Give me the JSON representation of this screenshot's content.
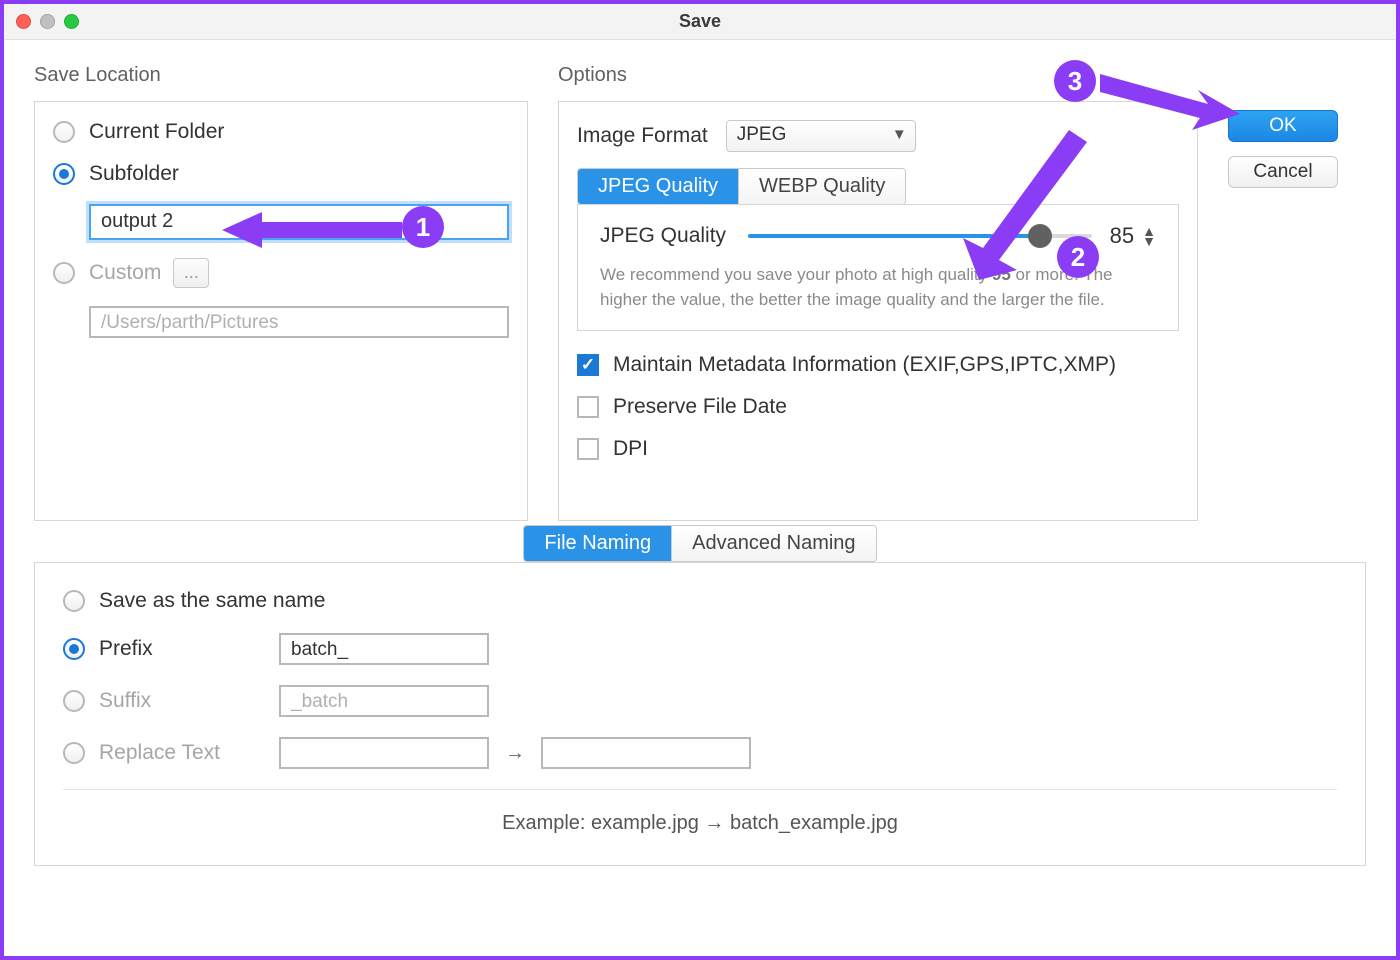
{
  "window": {
    "title": "Save"
  },
  "buttons": {
    "ok": "OK",
    "cancel": "Cancel"
  },
  "saveLocation": {
    "heading": "Save Location",
    "currentFolder": "Current Folder",
    "subfolder": "Subfolder",
    "subfolderValue": "output 2",
    "custom": "Custom",
    "customPlaceholder": "/Users/parth/Pictures",
    "browse": "..."
  },
  "options": {
    "heading": "Options",
    "imageFormatLabel": "Image Format",
    "imageFormatValue": "JPEG",
    "tabs": {
      "jpeg": "JPEG Quality",
      "webp": "WEBP Quality"
    },
    "quality": {
      "label": "JPEG Quality",
      "value": "85",
      "help_a": "We recommend you save your photo at high quality ",
      "help_b": "95",
      "help_c": " or more. The higher the value, the better the image quality and the larger the file."
    },
    "meta": "Maintain Metadata Information (EXIF,GPS,IPTC,XMP)",
    "preserveDate": "Preserve File Date",
    "dpi": "DPI"
  },
  "naming": {
    "tabFile": "File Naming",
    "tabAdvanced": "Advanced Naming",
    "sameName": "Save as the same name",
    "prefix": "Prefix",
    "prefixValue": "batch_",
    "suffix": "Suffix",
    "suffixPlaceholder": "_batch",
    "replace": "Replace Text",
    "arrow": "→",
    "example": "Example: example.jpg → batch_example.jpg"
  },
  "callouts": {
    "one": "1",
    "two": "2",
    "three": "3"
  }
}
